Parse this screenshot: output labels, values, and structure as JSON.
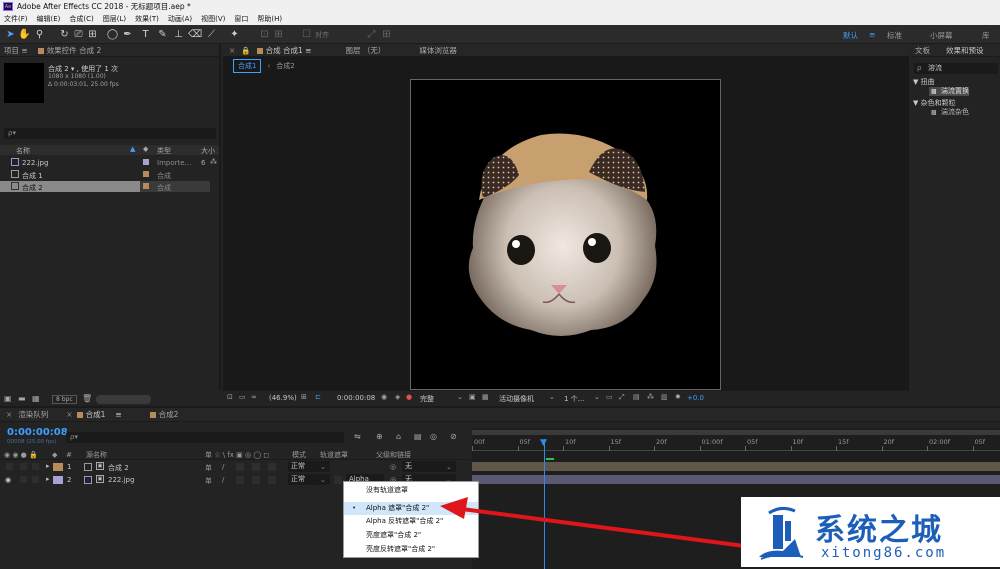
{
  "window": {
    "app_title": "Adobe After Effects CC 2018 - 无标题项目.aep *"
  },
  "menu": [
    "文件(F)",
    "编辑(E)",
    "合成(C)",
    "图层(L)",
    "效果(T)",
    "动画(A)",
    "视图(V)",
    "窗口",
    "帮助(H)"
  ],
  "toolbar": {
    "align_label": "对齐",
    "workspaces": [
      "默认",
      "标准",
      "小屏幕",
      "库"
    ],
    "workspace_menu_glyph": "≡"
  },
  "project": {
    "tab_label": "项目",
    "tab_menu": "≡",
    "effect_controls_label": "效果控件 合成 2",
    "comp_name": "合成 2 ▾ , 使用了 1 次",
    "comp_size": "1080 x 1080 (1.00)",
    "comp_duration": "Δ 0:00:03:01, 25.00 fps",
    "search_placeholder": "ρ▾",
    "columns": {
      "name": "名称",
      "type": "类型",
      "size": "大小"
    },
    "items": [
      {
        "name": "222.jpg",
        "type": "Importe...",
        "size": "6"
      },
      {
        "name": "合成 1",
        "type": "合成",
        "size": ""
      },
      {
        "name": "合成 2",
        "type": "合成",
        "size": ""
      }
    ],
    "bpc": "8 bpc"
  },
  "viewer": {
    "tabs": [
      "合成 合成1 ≡",
      "图层 （无）",
      "媒体浏览器"
    ],
    "sub_tabs": [
      "合成1",
      "合成2"
    ],
    "zoom": "(46.9%)",
    "timecode": "0:00:00:08",
    "resolution": "完整",
    "camera": "活动摄像机",
    "views": "1 个...",
    "exposure": "+0.0"
  },
  "effects": {
    "tabs": [
      "文板",
      "效果和预设"
    ],
    "search_value": "溶流",
    "groups": [
      {
        "label": "▼ 扭曲",
        "item": "湍流置换"
      },
      {
        "label": "▼ 杂色和颗粒",
        "item": "湍流杂色"
      }
    ]
  },
  "timeline": {
    "tabs": [
      "渲染队列",
      "合成1",
      "合成2"
    ],
    "timecode": "0:00:00:08",
    "fps": "00008 (25.00 fps)",
    "search_placeholder": "ρ▾",
    "columns": {
      "num": "#",
      "name": "源名称",
      "switches": "单 ☆ \\ fx ▣ ◎ ◯ ◻",
      "mode": "模式",
      "track": "轨道遮罩",
      "parent": "父级和链接"
    },
    "layers": [
      {
        "num": "1",
        "name": "合成 2",
        "mode": "正常",
        "track": "",
        "parent": "无"
      },
      {
        "num": "2",
        "name": "222.jpg",
        "mode": "正常",
        "track": "Alpha",
        "parent": "无"
      }
    ],
    "ruler": [
      "00f",
      "05f",
      "10f",
      "15f",
      "20f",
      "01:00f",
      "05f",
      "10f",
      "15f",
      "20f",
      "02:00f",
      "05f",
      "10f"
    ]
  },
  "dropdown": {
    "items": [
      {
        "label": "没有轨道遮罩",
        "selected": false
      },
      {
        "label": "Alpha 遮罩\"合成 2\"",
        "selected": true
      },
      {
        "label": "Alpha 反转遮罩\"合成 2\"",
        "selected": false
      },
      {
        "label": "亮度遮罩\"合成 2\"",
        "selected": false
      },
      {
        "label": "亮度反转遮罩\"合成 2\"",
        "selected": false
      }
    ]
  },
  "watermark": {
    "title": "系统之城",
    "url": "xitong86.com"
  },
  "colors": {
    "accent_blue": "#2d8ceb",
    "label_tan": "#b58c5a",
    "label_lavender": "#a9a1d6",
    "arrow_red": "#e0151b"
  }
}
